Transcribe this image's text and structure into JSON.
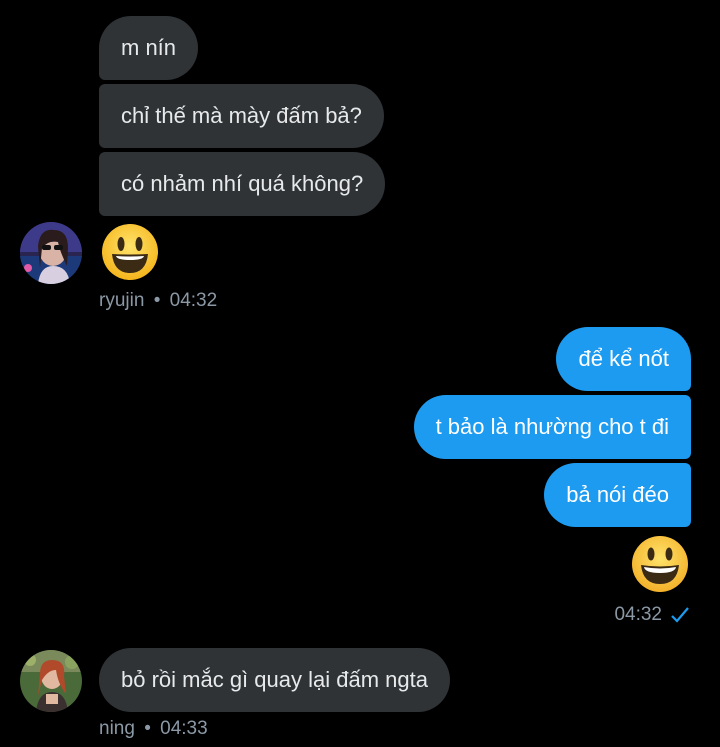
{
  "conversation": {
    "incoming_group1": {
      "messages": [
        "m nín",
        "chỉ thế mà mày đấm bả?",
        "có nhảm nhí quá không?"
      ],
      "sender": "ryujin",
      "time": "04:32",
      "emoji": "smiley-emoji"
    },
    "outgoing_group": {
      "messages": [
        "để kể nốt",
        "t bảo là nhường cho t đi",
        "bả nói đéo"
      ],
      "time": "04:32",
      "emoji": "grinning-emoji",
      "read_icon": "checkmark-icon"
    },
    "incoming_group2": {
      "messages": [
        "bỏ rồi mắc gì quay lại đấm ngta"
      ],
      "sender": "ning",
      "time": "04:33"
    }
  },
  "colors": {
    "incoming_bubble": "#2f3336",
    "outgoing_bubble": "#1d9bf0",
    "meta_text": "#8b98a5"
  }
}
